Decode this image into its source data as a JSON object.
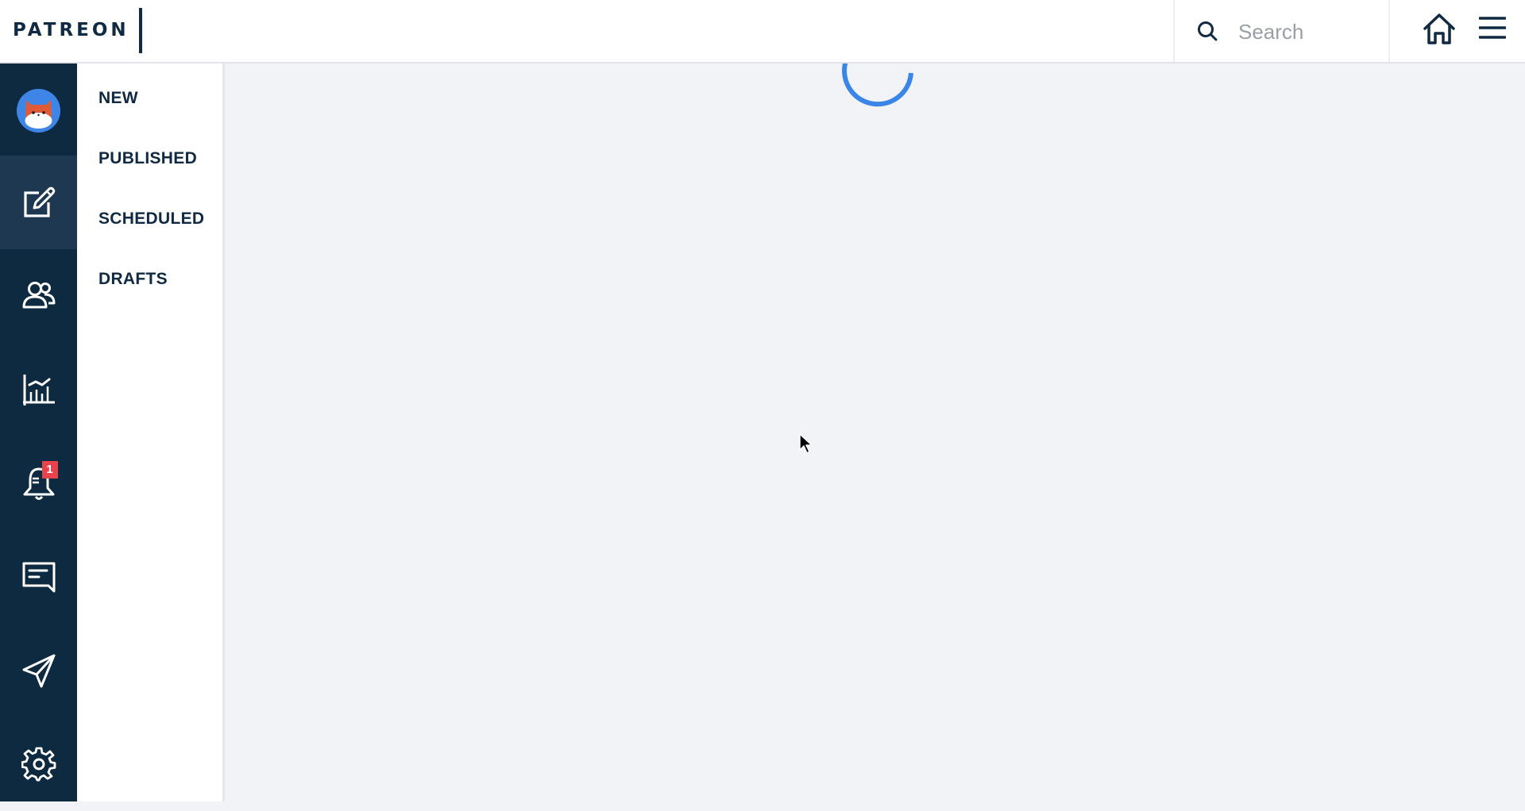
{
  "header": {
    "logo_text": "PATREON",
    "search": {
      "placeholder": "Search",
      "value": "",
      "icon": "search-icon"
    },
    "home_icon": "home-icon",
    "menu_icon": "hamburger-menu-icon"
  },
  "rail": {
    "avatar_icon": "fox-avatar",
    "items": [
      {
        "id": "posts",
        "icon": "edit-post-icon",
        "active": true
      },
      {
        "id": "patrons",
        "icon": "users-icon",
        "active": false
      },
      {
        "id": "insights",
        "icon": "chart-icon",
        "active": false
      },
      {
        "id": "notifications",
        "icon": "bell-icon",
        "active": false,
        "badge": "1"
      },
      {
        "id": "messages",
        "icon": "message-icon",
        "active": false
      },
      {
        "id": "promote",
        "icon": "send-icon",
        "active": false
      },
      {
        "id": "settings",
        "icon": "gear-icon",
        "active": false
      }
    ]
  },
  "submenu": {
    "items": [
      {
        "label": "NEW"
      },
      {
        "label": "PUBLISHED"
      },
      {
        "label": "SCHEDULED"
      },
      {
        "label": "DRAFTS"
      }
    ]
  },
  "main": {
    "state": "loading",
    "spinner_icon": "loading-spinner-icon"
  },
  "colors": {
    "rail_bg": "#0e2a41",
    "rail_active_bg": "#1d3850",
    "spinner": "#3a86e8",
    "badge": "#e8424a",
    "text_dark": "#0f2a42",
    "main_bg": "#f2f3f6"
  }
}
